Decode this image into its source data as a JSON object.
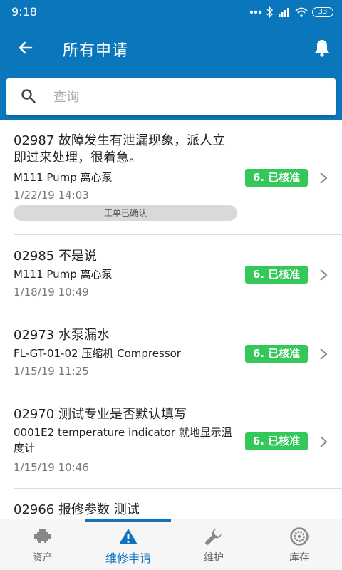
{
  "status_bar": {
    "time": "9:18",
    "battery": "33"
  },
  "app_bar": {
    "title": "所有申请"
  },
  "search": {
    "placeholder": "查询"
  },
  "requests": [
    {
      "title": "02987 故障发生有泄漏现象，派人立即过来处理，很着急。",
      "asset": "M111 Pump 离心泵",
      "time": "1/22/19 14:03",
      "tag": "工单已确认",
      "status": "6. 已核准"
    },
    {
      "title": "02985 不是说",
      "asset": "M111 Pump 离心泵",
      "time": "1/18/19 10:49",
      "status": "6. 已核准"
    },
    {
      "title": "02973 水泵漏水",
      "asset": "FL-GT-01-02 压缩机 Compressor",
      "time": "1/15/19 11:25",
      "status": "6. 已核准"
    },
    {
      "title": "02970 测试专业是否默认填写",
      "asset": "0001E2 temperature indicator 就地显示温度计",
      "time": "1/15/19 10:46",
      "status": "6. 已核准"
    },
    {
      "title": "02966 报修参数 测试"
    }
  ],
  "bottom_nav": [
    {
      "label": "资产",
      "icon": "engine-icon",
      "active": false
    },
    {
      "label": "维修申请",
      "icon": "warning-icon",
      "active": true
    },
    {
      "label": "维护",
      "icon": "wrench-icon",
      "active": false
    },
    {
      "label": "库存",
      "icon": "gear-disc-icon",
      "active": false
    }
  ],
  "colors": {
    "primary": "#0a77bd",
    "badge": "#34c759",
    "active_nav": "#1273bd"
  }
}
